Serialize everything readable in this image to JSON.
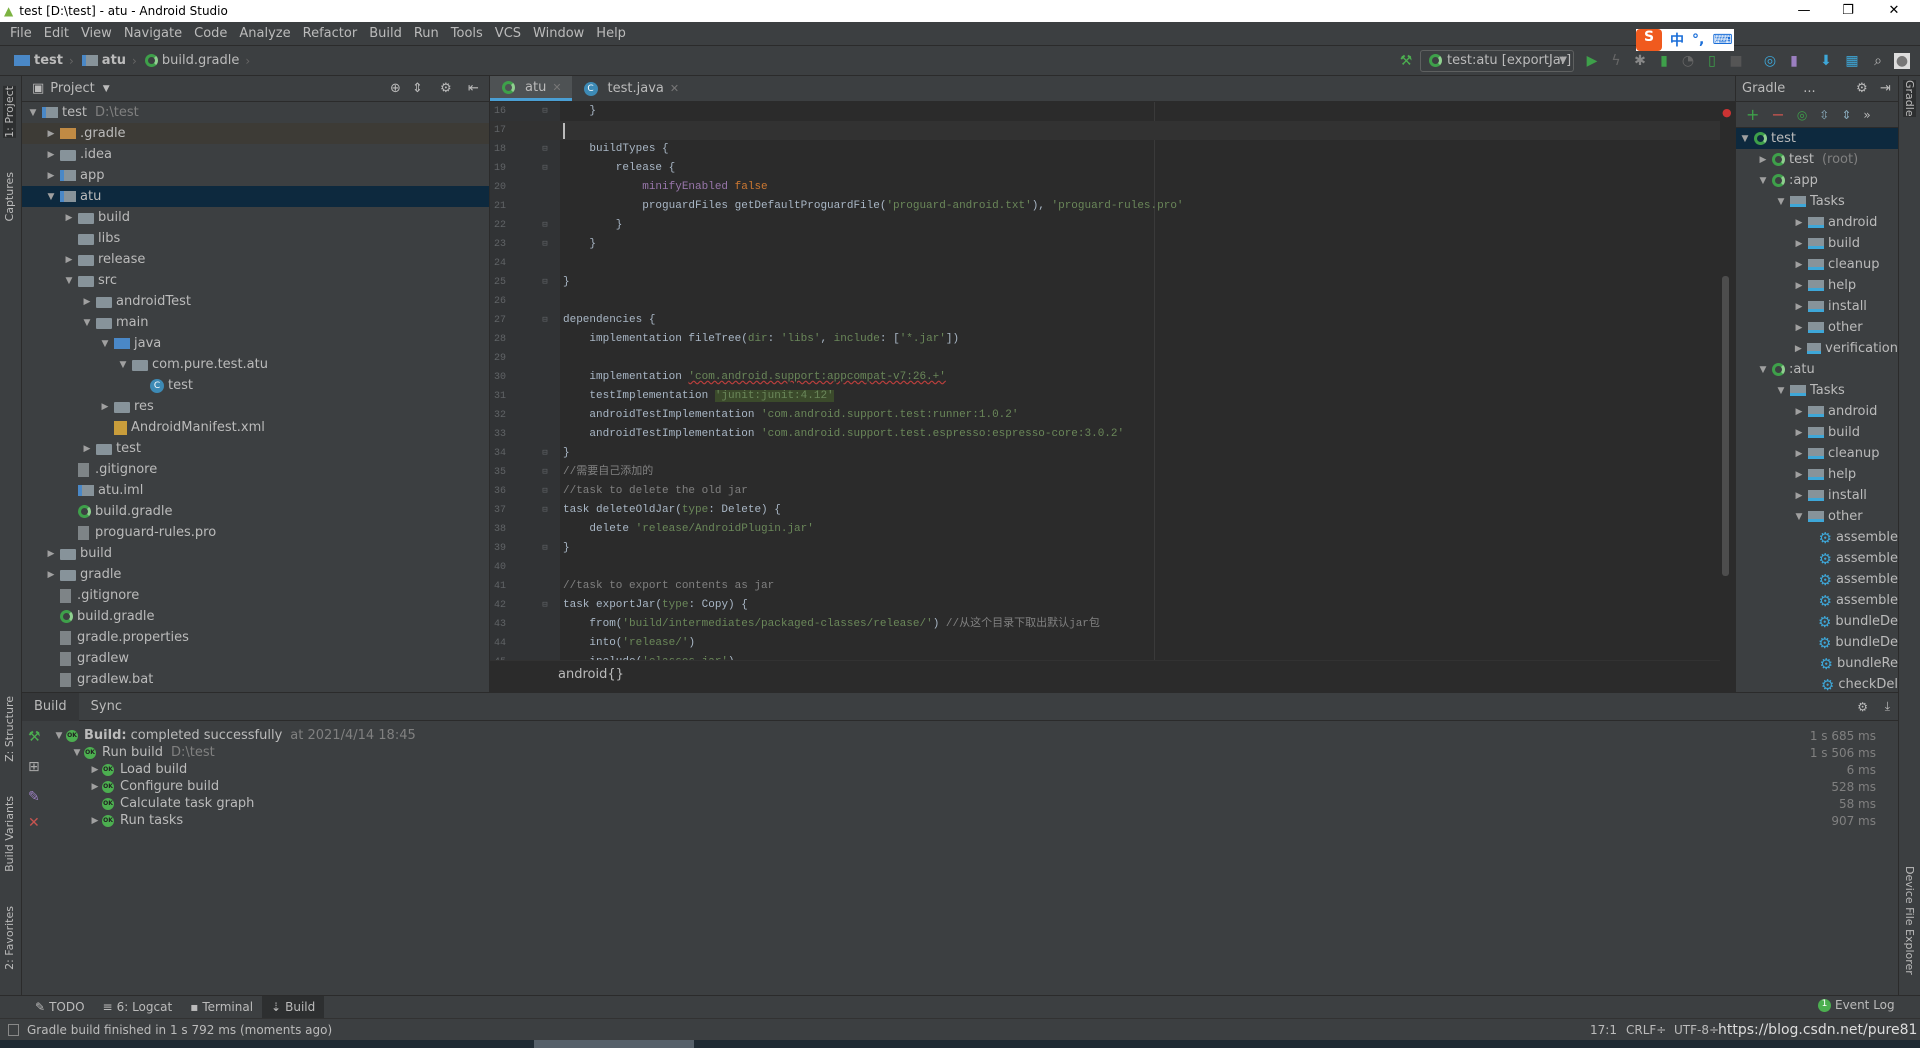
{
  "window": {
    "title": "test [D:\\test] - atu - Android Studio",
    "minimize": "—",
    "maximize": "❐",
    "close": "✕"
  },
  "menu": [
    "File",
    "Edit",
    "View",
    "Navigate",
    "Code",
    "Analyze",
    "Refactor",
    "Build",
    "Run",
    "Tools",
    "VCS",
    "Window",
    "Help"
  ],
  "breadcrumb": [
    "test",
    "atu",
    "build.gradle"
  ],
  "toolbar": {
    "run_config": "test:atu [exportJar]"
  },
  "ime": {
    "logo": "S",
    "mode": "中",
    "punct": "°,",
    "keyboard": "⌨"
  },
  "left_strip": [
    "1: Project",
    "Captures",
    "Z: Structure",
    "Build Variants",
    "2: Favorites"
  ],
  "right_strip": [
    "Gradle",
    "Device File Explorer"
  ],
  "project": {
    "title": "Project",
    "items": [
      {
        "level": 0,
        "state": "open",
        "icon": "module",
        "label": "test",
        "hint": "D:\\test"
      },
      {
        "level": 1,
        "state": "closed",
        "icon": "folder-orange",
        "label": ".gradle",
        "excluded": true
      },
      {
        "level": 1,
        "state": "closed",
        "icon": "folder",
        "label": ".idea"
      },
      {
        "level": 1,
        "state": "closed",
        "icon": "module",
        "label": "app"
      },
      {
        "level": 1,
        "state": "open",
        "icon": "module",
        "label": "atu",
        "selected": true
      },
      {
        "level": 2,
        "state": "closed",
        "icon": "folder",
        "label": "build"
      },
      {
        "level": 2,
        "state": "none",
        "icon": "folder",
        "label": "libs"
      },
      {
        "level": 2,
        "state": "closed",
        "icon": "folder",
        "label": "release"
      },
      {
        "level": 2,
        "state": "open",
        "icon": "folder",
        "label": "src"
      },
      {
        "level": 3,
        "state": "closed",
        "icon": "folder",
        "label": "androidTest"
      },
      {
        "level": 3,
        "state": "open",
        "icon": "folder",
        "label": "main"
      },
      {
        "level": 4,
        "state": "open",
        "icon": "folder-blue",
        "label": "java"
      },
      {
        "level": 5,
        "state": "open",
        "icon": "folder",
        "label": "com.pure.test.atu"
      },
      {
        "level": 6,
        "state": "none",
        "icon": "class",
        "label": "test"
      },
      {
        "level": 4,
        "state": "closed",
        "icon": "folder",
        "label": "res"
      },
      {
        "level": 4,
        "state": "none",
        "icon": "xml",
        "label": "AndroidManifest.xml"
      },
      {
        "level": 3,
        "state": "closed",
        "icon": "folder",
        "label": "test"
      },
      {
        "level": 2,
        "state": "none",
        "icon": "file",
        "label": ".gitignore"
      },
      {
        "level": 2,
        "state": "none",
        "icon": "module",
        "label": "atu.iml"
      },
      {
        "level": 2,
        "state": "none",
        "icon": "gradle",
        "label": "build.gradle"
      },
      {
        "level": 2,
        "state": "none",
        "icon": "file",
        "label": "proguard-rules.pro"
      },
      {
        "level": 1,
        "state": "closed",
        "icon": "folder",
        "label": "build"
      },
      {
        "level": 1,
        "state": "closed",
        "icon": "folder",
        "label": "gradle"
      },
      {
        "level": 1,
        "state": "none",
        "icon": "file",
        "label": ".gitignore"
      },
      {
        "level": 1,
        "state": "none",
        "icon": "gradle",
        "label": "build.gradle"
      },
      {
        "level": 1,
        "state": "none",
        "icon": "file",
        "label": "gradle.properties"
      },
      {
        "level": 1,
        "state": "none",
        "icon": "file",
        "label": "gradlew"
      },
      {
        "level": 1,
        "state": "none",
        "icon": "file",
        "label": "gradlew.bat"
      }
    ]
  },
  "editor": {
    "tabs": [
      {
        "label": "atu",
        "icon": "gradle",
        "active": true
      },
      {
        "label": "test.java",
        "icon": "class",
        "active": false
      }
    ],
    "current_line": 17,
    "lines": [
      {
        "n": 16,
        "fold": true,
        "tokens": [
          [
            "    }",
            "p"
          ]
        ]
      },
      {
        "n": 17,
        "tokens": []
      },
      {
        "n": 18,
        "fold": true,
        "tokens": [
          [
            "    buildTypes {",
            "p"
          ]
        ]
      },
      {
        "n": 19,
        "fold": true,
        "tokens": [
          [
            "        release {",
            "p"
          ]
        ]
      },
      {
        "n": 20,
        "tokens": [
          [
            "            ",
            "p"
          ],
          [
            "minifyEnabled",
            "f"
          ],
          [
            " ",
            "p"
          ],
          [
            "false",
            "k"
          ]
        ]
      },
      {
        "n": 21,
        "tokens": [
          [
            "            proguardFiles getDefaultProguardFile(",
            "p"
          ],
          [
            "'proguard-android.txt'",
            "s"
          ],
          [
            "), ",
            "p"
          ],
          [
            "'proguard-rules.pro'",
            "s"
          ]
        ]
      },
      {
        "n": 22,
        "fold": true,
        "tokens": [
          [
            "        }",
            "p"
          ]
        ]
      },
      {
        "n": 23,
        "fold": true,
        "tokens": [
          [
            "    }",
            "p"
          ]
        ]
      },
      {
        "n": 24,
        "tokens": []
      },
      {
        "n": 25,
        "fold": true,
        "tokens": [
          [
            "}",
            "p"
          ]
        ]
      },
      {
        "n": 26,
        "tokens": []
      },
      {
        "n": 27,
        "fold": true,
        "tokens": [
          [
            "dependencies {",
            "p"
          ]
        ]
      },
      {
        "n": 28,
        "tokens": [
          [
            "    implementation fileTree(",
            "p"
          ],
          [
            "dir",
            "n"
          ],
          [
            ": ",
            "p"
          ],
          [
            "'libs'",
            "s"
          ],
          [
            ", ",
            "p"
          ],
          [
            "include",
            "n"
          ],
          [
            ": [",
            "p"
          ],
          [
            "'*.jar'",
            "s"
          ],
          [
            "])",
            "p"
          ]
        ]
      },
      {
        "n": 29,
        "tokens": []
      },
      {
        "n": 30,
        "tokens": [
          [
            "    implementation ",
            "p"
          ],
          [
            "'com.android.support:appcompat-v7:26.+'",
            "err"
          ]
        ]
      },
      {
        "n": 31,
        "tokens": [
          [
            "    testImplementation ",
            "p"
          ],
          [
            "'junit:junit:4.12'",
            "hl"
          ]
        ]
      },
      {
        "n": 32,
        "tokens": [
          [
            "    androidTestImplementation ",
            "p"
          ],
          [
            "'com.android.support.test:runner:1.0.2'",
            "s"
          ]
        ]
      },
      {
        "n": 33,
        "tokens": [
          [
            "    androidTestImplementation ",
            "p"
          ],
          [
            "'com.android.support.test.espresso:espresso-core:3.0.2'",
            "s"
          ]
        ]
      },
      {
        "n": 34,
        "fold": true,
        "tokens": [
          [
            "}",
            "p"
          ]
        ]
      },
      {
        "n": 35,
        "fold": true,
        "tokens": [
          [
            "//需要自己添加的",
            "c"
          ]
        ]
      },
      {
        "n": 36,
        "fold": true,
        "tokens": [
          [
            "//task to delete the old jar",
            "c"
          ]
        ]
      },
      {
        "n": 37,
        "fold": true,
        "tokens": [
          [
            "task deleteOldJar(",
            "p"
          ],
          [
            "type",
            "n"
          ],
          [
            ": Delete) {",
            "p"
          ]
        ]
      },
      {
        "n": 38,
        "tokens": [
          [
            "    delete ",
            "p"
          ],
          [
            "'release/AndroidPlugin.jar'",
            "s"
          ]
        ]
      },
      {
        "n": 39,
        "fold": true,
        "tokens": [
          [
            "}",
            "p"
          ]
        ]
      },
      {
        "n": 40,
        "tokens": []
      },
      {
        "n": 41,
        "tokens": [
          [
            "//task to export contents as jar",
            "c"
          ]
        ]
      },
      {
        "n": 42,
        "fold": true,
        "tokens": [
          [
            "task exportJar(",
            "p"
          ],
          [
            "type",
            "n"
          ],
          [
            ": Copy) {",
            "p"
          ]
        ]
      },
      {
        "n": 43,
        "tokens": [
          [
            "    from(",
            "p"
          ],
          [
            "'build/intermediates/packaged-classes/release/'",
            "s"
          ],
          [
            ") ",
            "p"
          ],
          [
            "//从这个目录下取出默认jar包",
            "c"
          ]
        ]
      },
      {
        "n": 44,
        "tokens": [
          [
            "    into(",
            "p"
          ],
          [
            "'release/'",
            "s"
          ],
          [
            ")",
            "p"
          ]
        ]
      },
      {
        "n": 45,
        "tokens": [
          [
            "    include(",
            "p"
          ],
          [
            "'classes.jar'",
            "s"
          ],
          [
            ")",
            "p"
          ]
        ]
      }
    ],
    "bottom_breadcrumb": "android{}"
  },
  "gradle": {
    "title": "Gradle",
    "more": "...",
    "items": [
      {
        "level": 0,
        "state": "open",
        "icon": "gradle",
        "label": "test",
        "selected": true
      },
      {
        "level": 1,
        "state": "closed",
        "icon": "gradle",
        "label": "test",
        "hint": "(root)"
      },
      {
        "level": 1,
        "state": "open",
        "icon": "gradle",
        "label": ":app"
      },
      {
        "level": 2,
        "state": "open",
        "icon": "tasks",
        "label": "Tasks"
      },
      {
        "level": 3,
        "state": "closed",
        "icon": "tasks",
        "label": "android"
      },
      {
        "level": 3,
        "state": "closed",
        "icon": "tasks",
        "label": "build"
      },
      {
        "level": 3,
        "state": "closed",
        "icon": "tasks",
        "label": "cleanup"
      },
      {
        "level": 3,
        "state": "closed",
        "icon": "tasks",
        "label": "help"
      },
      {
        "level": 3,
        "state": "closed",
        "icon": "tasks",
        "label": "install"
      },
      {
        "level": 3,
        "state": "closed",
        "icon": "tasks",
        "label": "other"
      },
      {
        "level": 3,
        "state": "closed",
        "icon": "tasks",
        "label": "verification"
      },
      {
        "level": 1,
        "state": "open",
        "icon": "gradle",
        "label": ":atu"
      },
      {
        "level": 2,
        "state": "open",
        "icon": "tasks",
        "label": "Tasks"
      },
      {
        "level": 3,
        "state": "closed",
        "icon": "tasks",
        "label": "android"
      },
      {
        "level": 3,
        "state": "closed",
        "icon": "tasks",
        "label": "build"
      },
      {
        "level": 3,
        "state": "closed",
        "icon": "tasks",
        "label": "cleanup"
      },
      {
        "level": 3,
        "state": "closed",
        "icon": "tasks",
        "label": "help"
      },
      {
        "level": 3,
        "state": "closed",
        "icon": "tasks",
        "label": "install"
      },
      {
        "level": 3,
        "state": "open",
        "icon": "tasks",
        "label": "other"
      },
      {
        "level": 4,
        "state": "none",
        "icon": "gear",
        "label": "assemble"
      },
      {
        "level": 4,
        "state": "none",
        "icon": "gear",
        "label": "assemble"
      },
      {
        "level": 4,
        "state": "none",
        "icon": "gear",
        "label": "assemble"
      },
      {
        "level": 4,
        "state": "none",
        "icon": "gear",
        "label": "assemble"
      },
      {
        "level": 4,
        "state": "none",
        "icon": "gear",
        "label": "bundleDe"
      },
      {
        "level": 4,
        "state": "none",
        "icon": "gear",
        "label": "bundleDe"
      },
      {
        "level": 4,
        "state": "none",
        "icon": "gear",
        "label": "bundleRe"
      },
      {
        "level": 4,
        "state": "none",
        "icon": "gear",
        "label": "checkDel"
      }
    ]
  },
  "build": {
    "tabs": [
      "Build",
      "Sync"
    ],
    "rows": [
      {
        "level": 0,
        "state": "open",
        "bold": "Build:",
        "label": "completed successfully",
        "hint": "at 2021/4/14 18:45",
        "time": "1 s 685 ms"
      },
      {
        "level": 1,
        "state": "open",
        "label": "Run build",
        "hint": "D:\\test",
        "time": "1 s 506 ms"
      },
      {
        "level": 2,
        "state": "closed",
        "label": "Load build",
        "time": "6 ms"
      },
      {
        "level": 2,
        "state": "closed",
        "label": "Configure build",
        "time": "528 ms"
      },
      {
        "level": 2,
        "state": "none",
        "label": "Calculate task graph",
        "time": "58 ms"
      },
      {
        "level": 2,
        "state": "closed",
        "label": "Run tasks",
        "time": "907 ms"
      }
    ],
    "ok_badge": "OK"
  },
  "toolwindows": [
    {
      "label": "TODO",
      "icon": "todo"
    },
    {
      "label": "6: Logcat",
      "icon": "logcat"
    },
    {
      "label": "Terminal",
      "icon": "terminal"
    },
    {
      "label": "Build",
      "icon": "build",
      "active": true
    }
  ],
  "event_log": "Event Log",
  "event_count": "1",
  "status": {
    "message": "Gradle build finished in 1 s 792 ms (moments ago)",
    "position": "17:1",
    "line_sep": "CRLF÷",
    "encoding": "UTF-8÷",
    "watermark": "https://blog.csdn.net/pure81"
  },
  "colors": {
    "editor_bg": "#2b2b2b",
    "panel_bg": "#3c3f41",
    "selection": "#0d293e",
    "string": "#6a8759",
    "keyword": "#cc7832",
    "accent": "#4a9fd4"
  }
}
